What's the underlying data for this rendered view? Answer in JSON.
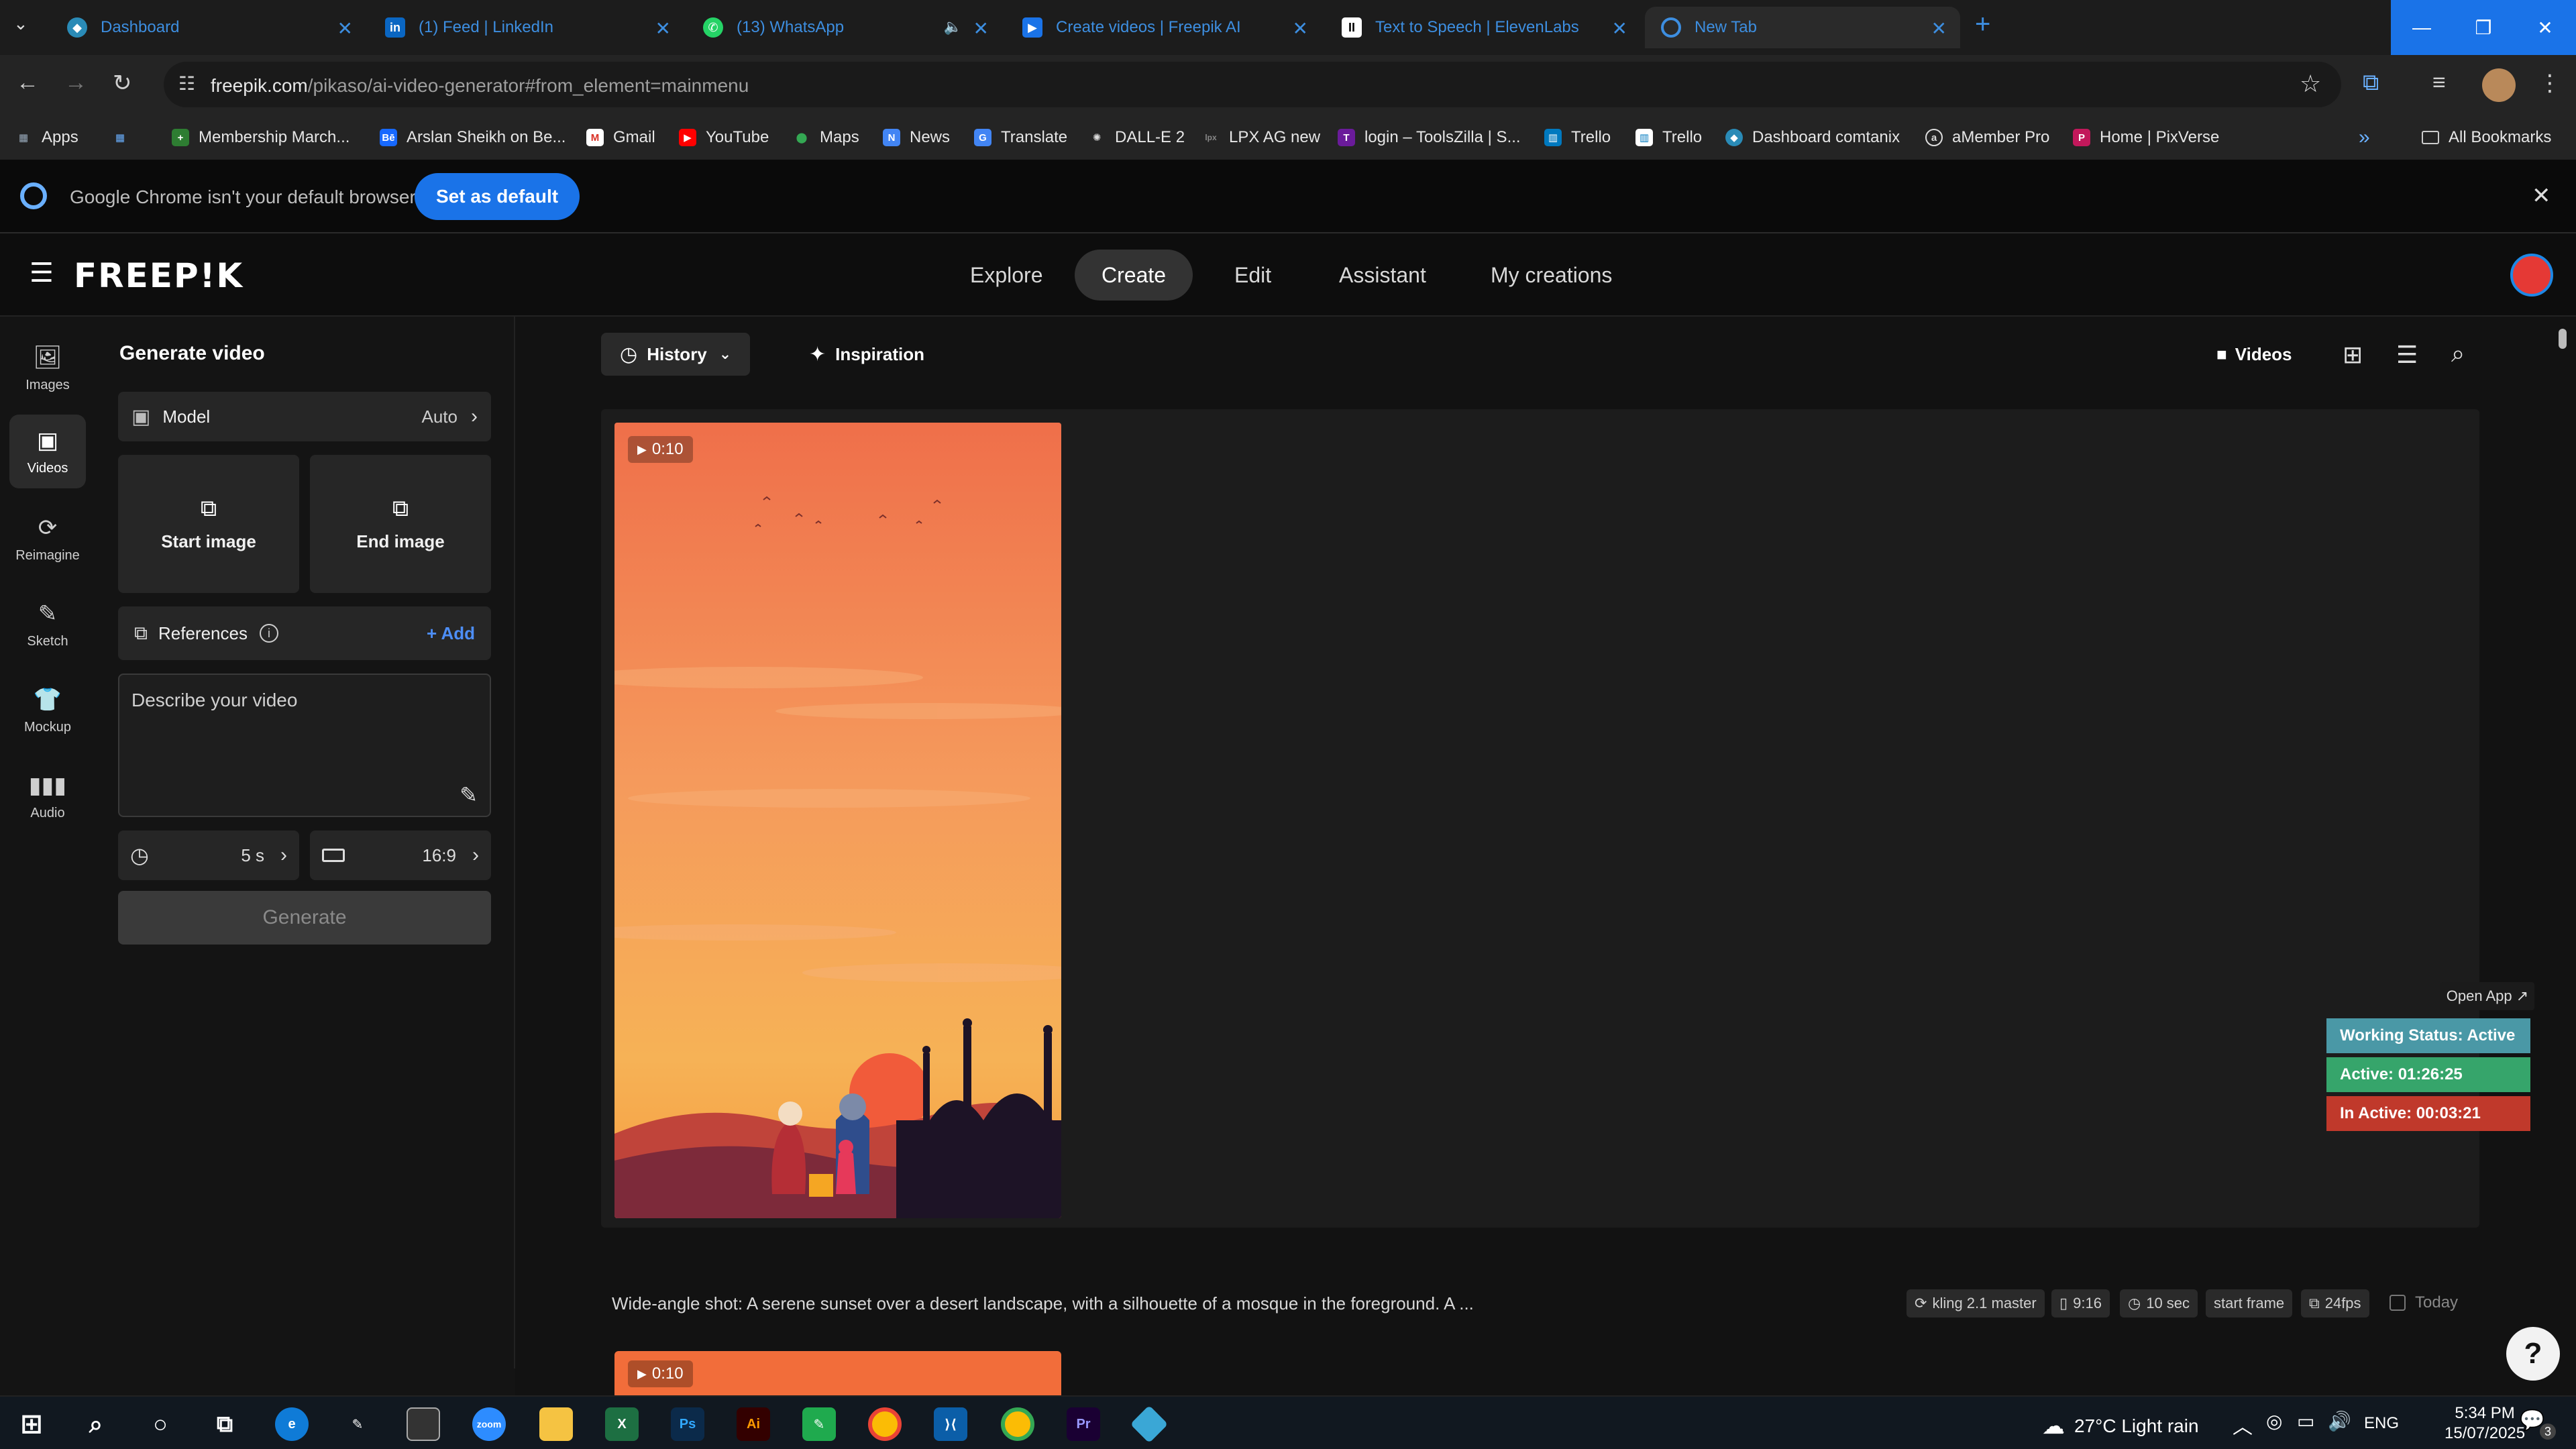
{
  "browser": {
    "tabs": [
      {
        "title": "Dashboard",
        "icon": "dashboard-icon",
        "color": "#2a8bb7"
      },
      {
        "title": "(1) Feed | LinkedIn",
        "icon": "linkedin-icon",
        "color": "#0a66c2"
      },
      {
        "title": "(13) WhatsApp",
        "icon": "whatsapp-icon",
        "color": "#25d366"
      },
      {
        "title": "Create videos | Freepik AI",
        "icon": "freepik-icon",
        "color": "#1a73e8"
      },
      {
        "title": "Text to Speech | ElevenLabs",
        "icon": "elevenlabs-icon",
        "color": "#ffffff"
      },
      {
        "title": "New Tab",
        "icon": "chrome-icon",
        "color": "#3d8ee0"
      }
    ],
    "url_host": "freepik.com",
    "url_path": "/pikaso/ai-video-generator#from_element=mainmenu",
    "bookmarks": [
      "Apps",
      "Membership March...",
      "Arslan Sheikh on Be...",
      "Gmail",
      "YouTube",
      "Maps",
      "News",
      "Translate",
      "DALL-E 2",
      "LPX AG new",
      "login – ToolsZilla | S...",
      "Trello",
      "Trello",
      "Dashboard comtanix",
      "aMember Pro",
      "Home | PixVerse"
    ],
    "all_bookmarks": "All Bookmarks",
    "infobar_text": "Google Chrome isn't your default browser",
    "set_default_label": "Set as default"
  },
  "app": {
    "logo": "FREEP!K",
    "nav": [
      "Explore",
      "Create",
      "Edit",
      "Assistant",
      "My creations"
    ],
    "nav_active": "Create",
    "rail": [
      {
        "label": "Images",
        "icon": "images-icon"
      },
      {
        "label": "Videos",
        "icon": "videos-icon"
      },
      {
        "label": "Reimagine",
        "icon": "reimagine-icon"
      },
      {
        "label": "Sketch",
        "icon": "sketch-icon"
      },
      {
        "label": "Mockup",
        "icon": "mockup-icon"
      },
      {
        "label": "Audio",
        "icon": "audio-icon"
      }
    ]
  },
  "panel": {
    "title": "Generate video",
    "model_label": "Model",
    "model_value": "Auto",
    "start_image": "Start image",
    "end_image": "End image",
    "references_label": "References",
    "add_label": "+ Add",
    "prompt_placeholder": "Describe your video",
    "duration": "5 s",
    "aspect": "16:9",
    "generate": "Generate"
  },
  "main": {
    "history": "History",
    "inspiration": "Inspiration",
    "videos": "Videos",
    "result": {
      "duration": "0:10",
      "prompt": "Wide-angle shot: A serene sunset over a desert landscape, with a silhouette of a mosque in the foreground. A ...",
      "model": "kling 2.1 master",
      "ratio": "9:16",
      "length": "10 sec",
      "mode": "start frame",
      "fps": "24fps",
      "date": "Today"
    },
    "second_duration": "0:10"
  },
  "tracker": {
    "open_app": "Open App ↗",
    "status": "Working Status: Active",
    "active": "Active: 01:26:25",
    "inactive": "In Active: 00:03:21",
    "colors": {
      "status": "#4a98a6",
      "active": "#36a56b",
      "inactive": "#c0392b"
    }
  },
  "taskbar": {
    "weather": "27°C  Light rain",
    "lang": "ENG",
    "time": "5:34 PM",
    "date": "15/07/2025",
    "notifications": "3"
  }
}
